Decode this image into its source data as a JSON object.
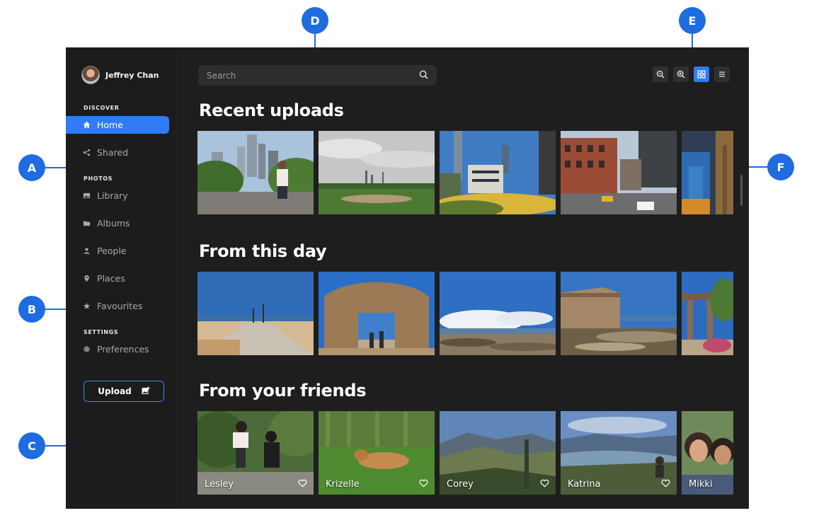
{
  "user": {
    "name": "Jeffrey Chan"
  },
  "sidebar": {
    "discover_label": "DISCOVER",
    "photos_label": "PHOTOS",
    "settings_label": "SETTINGS",
    "items": [
      {
        "label": "Home",
        "icon": "home-icon"
      },
      {
        "label": "Shared",
        "icon": "share-icon"
      },
      {
        "label": "Library",
        "icon": "image-icon"
      },
      {
        "label": "Albums",
        "icon": "folder-icon"
      },
      {
        "label": "People",
        "icon": "person-icon"
      },
      {
        "label": "Places",
        "icon": "pin-icon"
      },
      {
        "label": "Favourites",
        "icon": "star-icon"
      },
      {
        "label": "Preferences",
        "icon": "gear-icon"
      }
    ],
    "upload_label": "Upload"
  },
  "search": {
    "placeholder": "Search"
  },
  "sections": {
    "recent": "Recent uploads",
    "day": "From this day",
    "friends": "From your friends"
  },
  "friends": [
    "Lesley",
    "Krizelle",
    "Corey",
    "Katrina",
    "Mikki"
  ],
  "markers": [
    "A",
    "B",
    "C",
    "D",
    "E",
    "F"
  ],
  "colors": {
    "accent": "#2f7cf6",
    "background": "#1e1e1f",
    "annotation": "#1f6be0"
  }
}
